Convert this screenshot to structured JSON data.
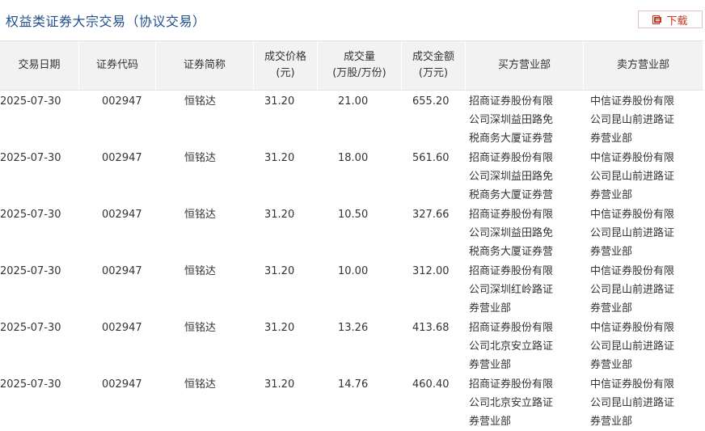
{
  "page": {
    "title": "权益类证券大宗交易（协议交易）",
    "download_label": "下载"
  },
  "table": {
    "headers": [
      {
        "l1": "交易日期",
        "l2": ""
      },
      {
        "l1": "证券代码",
        "l2": ""
      },
      {
        "l1": "证券简称",
        "l2": ""
      },
      {
        "l1": "成交价格",
        "l2": "(元)"
      },
      {
        "l1": "成交量",
        "l2": "(万股/万份)"
      },
      {
        "l1": "成交金额",
        "l2": "(万元)"
      },
      {
        "l1": "买方营业部",
        "l2": ""
      },
      {
        "l1": "卖方营业部",
        "l2": ""
      }
    ],
    "rows": [
      {
        "date": "2025-07-30",
        "code": "002947",
        "name": "恒铭达",
        "price": "31.20",
        "volume": "21.00",
        "amount": "655.20",
        "buyer": "招商证券股份有限公司深圳益田路免税商务大厦证券营",
        "seller": "中信证券股份有限公司昆山前进路证券营业部"
      },
      {
        "date": "2025-07-30",
        "code": "002947",
        "name": "恒铭达",
        "price": "31.20",
        "volume": "18.00",
        "amount": "561.60",
        "buyer": "招商证券股份有限公司深圳益田路免税商务大厦证券营",
        "seller": "中信证券股份有限公司昆山前进路证券营业部"
      },
      {
        "date": "2025-07-30",
        "code": "002947",
        "name": "恒铭达",
        "price": "31.20",
        "volume": "10.50",
        "amount": "327.66",
        "buyer": "招商证券股份有限公司深圳益田路免税商务大厦证券营",
        "seller": "中信证券股份有限公司昆山前进路证券营业部"
      },
      {
        "date": "2025-07-30",
        "code": "002947",
        "name": "恒铭达",
        "price": "31.20",
        "volume": "10.00",
        "amount": "312.00",
        "buyer": "招商证券股份有限公司深圳红岭路证券营业部",
        "seller": "中信证券股份有限公司昆山前进路证券营业部"
      },
      {
        "date": "2025-07-30",
        "code": "002947",
        "name": "恒铭达",
        "price": "31.20",
        "volume": "13.26",
        "amount": "413.68",
        "buyer": "招商证券股份有限公司北京安立路证券营业部",
        "seller": "中信证券股份有限公司昆山前进路证券营业部"
      },
      {
        "date": "2025-07-30",
        "code": "002947",
        "name": "恒铭达",
        "price": "31.20",
        "volume": "14.76",
        "amount": "460.40",
        "buyer": "招商证券股份有限公司北京安立路证券营业部",
        "seller": "中信证券股份有限公司昆山前进路证券营业部"
      }
    ]
  },
  "icons": {
    "download": "file-download-icon"
  },
  "colors": {
    "title": "#1f4e8c",
    "download_accent": "#c8321e",
    "header_bg": "#f2f2f2"
  }
}
